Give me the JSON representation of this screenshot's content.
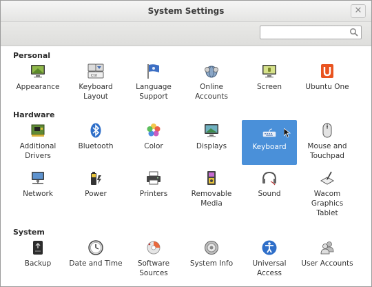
{
  "window": {
    "title": "System Settings",
    "close": "✕"
  },
  "search": {
    "placeholder": "",
    "value": ""
  },
  "sections": {
    "personal": {
      "title": "Personal",
      "items": [
        {
          "label": "Appearance",
          "icon": "appearance-icon"
        },
        {
          "label": "Keyboard Layout",
          "icon": "keyboard-layout-icon"
        },
        {
          "label": "Language Support",
          "icon": "language-flag-icon"
        },
        {
          "label": "Online Accounts",
          "icon": "online-accounts-icon"
        },
        {
          "label": "Screen",
          "icon": "screen-icon"
        },
        {
          "label": "Ubuntu One",
          "icon": "ubuntu-one-icon"
        }
      ]
    },
    "hardware": {
      "title": "Hardware",
      "items": [
        {
          "label": "Additional Drivers",
          "icon": "chip-icon"
        },
        {
          "label": "Bluetooth",
          "icon": "bluetooth-icon"
        },
        {
          "label": "Color",
          "icon": "color-icon"
        },
        {
          "label": "Displays",
          "icon": "displays-icon"
        },
        {
          "label": "Keyboard",
          "icon": "keyboard-icon"
        },
        {
          "label": "Mouse and Touchpad",
          "icon": "mouse-icon"
        },
        {
          "label": "Network",
          "icon": "network-icon"
        },
        {
          "label": "Power",
          "icon": "battery-icon"
        },
        {
          "label": "Printers",
          "icon": "printer-icon"
        },
        {
          "label": "Removable Media",
          "icon": "removable-media-icon"
        },
        {
          "label": "Sound",
          "icon": "sound-icon"
        },
        {
          "label": "Wacom Graphics Tablet",
          "icon": "tablet-icon"
        }
      ]
    },
    "system": {
      "title": "System",
      "items": [
        {
          "label": "Backup",
          "icon": "backup-icon"
        },
        {
          "label": "Date and Time",
          "icon": "clock-icon"
        },
        {
          "label": "Software Sources",
          "icon": "software-sources-icon"
        },
        {
          "label": "System Info",
          "icon": "system-info-icon"
        },
        {
          "label": "Universal Access",
          "icon": "universal-access-icon"
        },
        {
          "label": "User Accounts",
          "icon": "user-accounts-icon"
        }
      ]
    }
  },
  "colors": {
    "selected": "#4a90d9",
    "accent_orange": "#e95420"
  }
}
